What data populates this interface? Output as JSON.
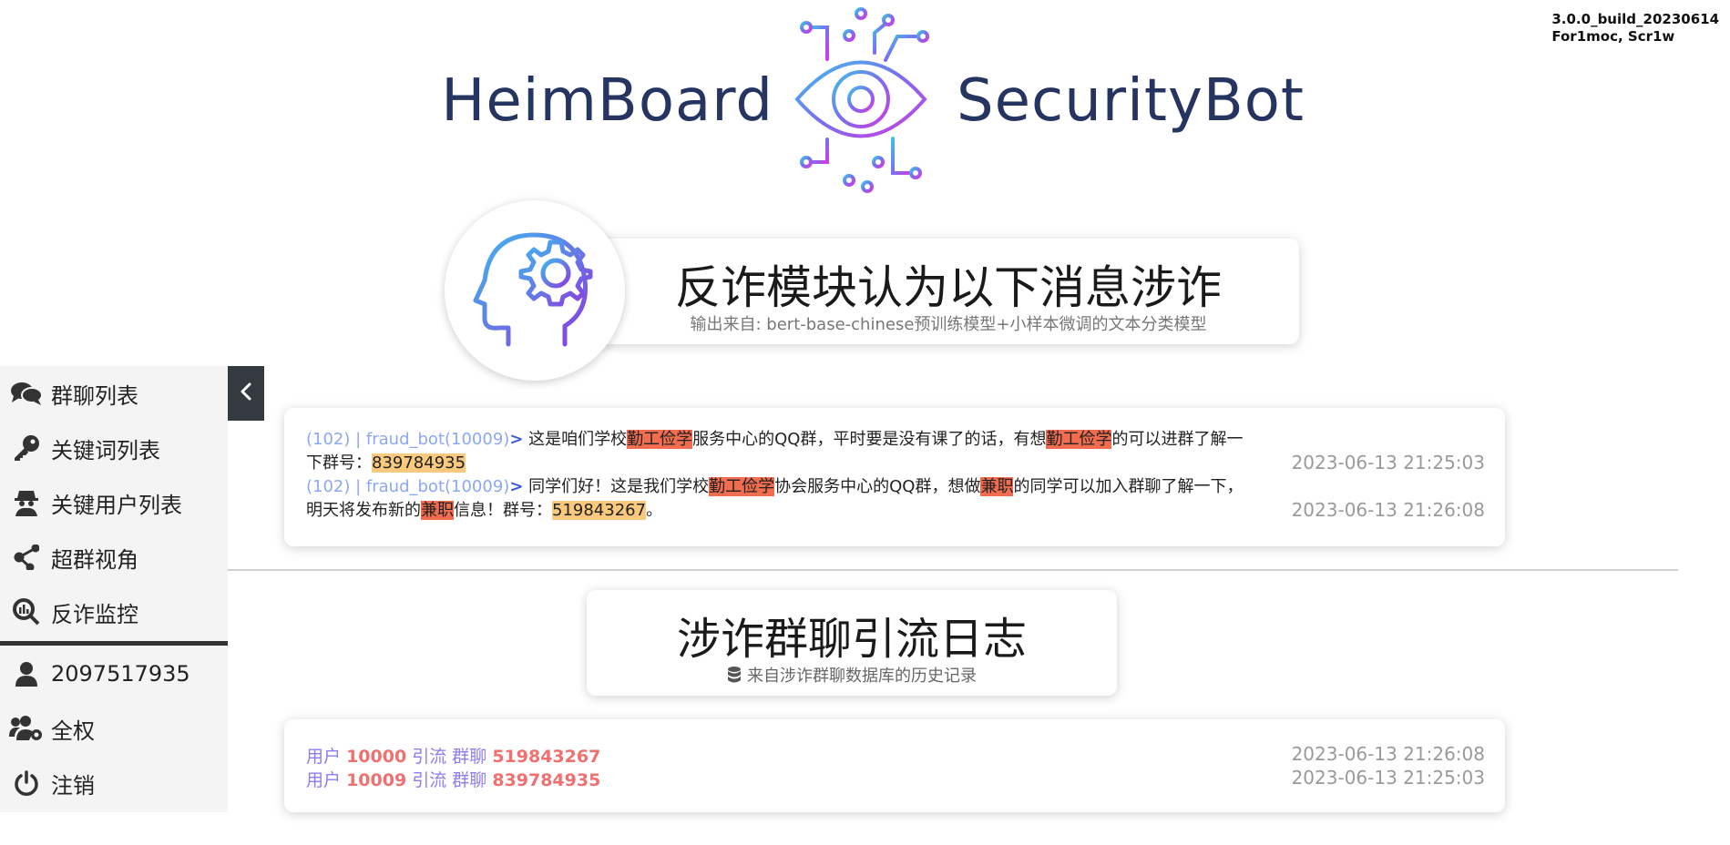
{
  "version": {
    "build": "3.0.0_build_20230614",
    "authors": "For1moc, Scr1w"
  },
  "brand": {
    "left_text": "HeimBoard",
    "right_text": "SecurityBot",
    "logo_icon": "eye-circuit-icon",
    "colors": {
      "text": "#263461",
      "gradient_start": "#3fc1e8",
      "gradient_end": "#c83de0"
    }
  },
  "hero": {
    "title": "反诈模块认为以下消息涉诈",
    "subtitle": "输出来自: bert-base-chinese预训练模型+小样本微调的文本分类模型",
    "icon": "head-gear-icon"
  },
  "messages": [
    {
      "source": "(102) | fraud_bot(10009)",
      "arrow": ">",
      "segments": [
        {
          "text": " 这是咱们学校",
          "hl": ""
        },
        {
          "text": "勤工俭学",
          "hl": "o"
        },
        {
          "text": "服务中心的QQ群，平时要是没有课了的话，有想",
          "hl": ""
        },
        {
          "text": "勤工俭学",
          "hl": "o"
        },
        {
          "text": "的可以进群了解一下群号：",
          "hl": ""
        },
        {
          "text": "839784935",
          "hl": "y"
        }
      ],
      "time": "2023-06-13 21:25:03"
    },
    {
      "source": "(102) | fraud_bot(10009)",
      "arrow": ">",
      "segments": [
        {
          "text": " 同学们好！这是我们学校",
          "hl": ""
        },
        {
          "text": "勤工俭学",
          "hl": "o"
        },
        {
          "text": "协会服务中心的QQ群，想做",
          "hl": ""
        },
        {
          "text": "兼职",
          "hl": "o"
        },
        {
          "text": "的同学可以加入群聊了解一下，明天将发布新的",
          "hl": ""
        },
        {
          "text": "兼职",
          "hl": "o"
        },
        {
          "text": "信息！群号：",
          "hl": ""
        },
        {
          "text": "519843267",
          "hl": "y"
        },
        {
          "text": "。",
          "hl": ""
        }
      ],
      "time": "2023-06-13 21:26:08"
    }
  ],
  "log_header": {
    "title": "涉诈群聊引流日志",
    "subtitle": "来自涉诈群聊数据库的历史记录",
    "icon": "database-icon"
  },
  "logs": [
    {
      "user_label": "用户",
      "user_id": "10000",
      "mid": "引流 群聊",
      "group_id": "519843267",
      "time": "2023-06-13 21:26:08"
    },
    {
      "user_label": "用户",
      "user_id": "10009",
      "mid": "引流 群聊",
      "group_id": "839784935",
      "time": "2023-06-13 21:25:03"
    }
  ],
  "sidebar": {
    "items": [
      {
        "label": "群聊列表",
        "icon": "comments-icon"
      },
      {
        "label": "关键词列表",
        "icon": "key-icon"
      },
      {
        "label": "关键用户列表",
        "icon": "user-secret-icon"
      },
      {
        "label": "超群视角",
        "icon": "share-nodes-icon"
      },
      {
        "label": "反诈监控",
        "icon": "search-chart-icon"
      },
      {
        "label": "2097517935",
        "icon": "user-icon"
      },
      {
        "label": "全权",
        "icon": "users-gear-icon"
      },
      {
        "label": "注销",
        "icon": "power-icon"
      }
    ],
    "collapse_icon": "chevron-left-icon"
  }
}
